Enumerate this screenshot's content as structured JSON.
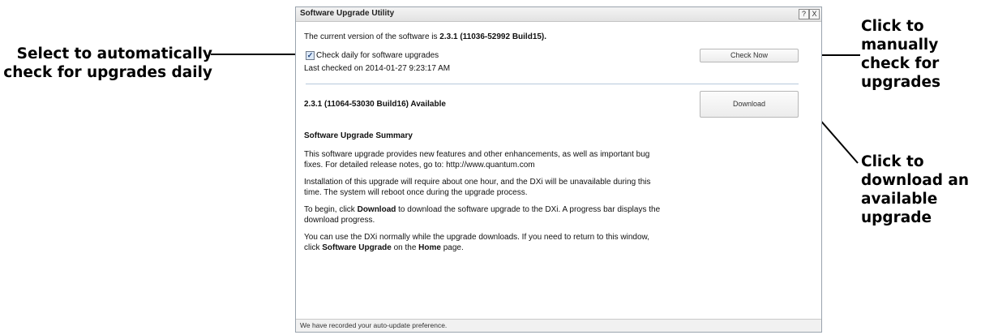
{
  "annotations": {
    "left": [
      "Select to automatically",
      "check for upgrades daily"
    ],
    "right_check": [
      "Click to",
      "manually",
      "check for",
      "upgrades"
    ],
    "right_download": [
      "Click to",
      "download an",
      "available",
      "upgrade"
    ]
  },
  "dialog": {
    "title": "Software Upgrade Utility",
    "help_button": "?",
    "close_button": "X",
    "current_version_prefix": "The current version of the software is ",
    "current_version": "2.3.1 (11036-52992 Build15).",
    "check_daily_checked": true,
    "check_daily_label": "Check daily for software upgrades",
    "last_checked": "Last checked on 2014-01-27 9:23:17 AM",
    "check_now_label": "Check Now",
    "available_version": "2.3.1 (11064-53030 Build16) Available",
    "download_label": "Download",
    "summary_heading": "Software Upgrade Summary",
    "para1": "This software upgrade provides new features and other enhancements, as well as important bug fixes. For detailed release notes, go to: http://www.quantum.com",
    "para2": "Installation of this upgrade will require about one hour, and the DXi will be unavailable during this time. The system will reboot once during the upgrade process.",
    "para3_a": "To begin, click ",
    "para3_b": "Download",
    "para3_c": " to download the software upgrade to the DXi. A progress bar displays the download progress.",
    "para4_a": "You can use the DXi normally while the upgrade downloads. If you need to return to this window, click ",
    "para4_b": "Software Upgrade",
    "para4_c": " on the ",
    "para4_d": "Home",
    "para4_e": " page.",
    "status_text": "We have recorded your auto-update preference."
  }
}
